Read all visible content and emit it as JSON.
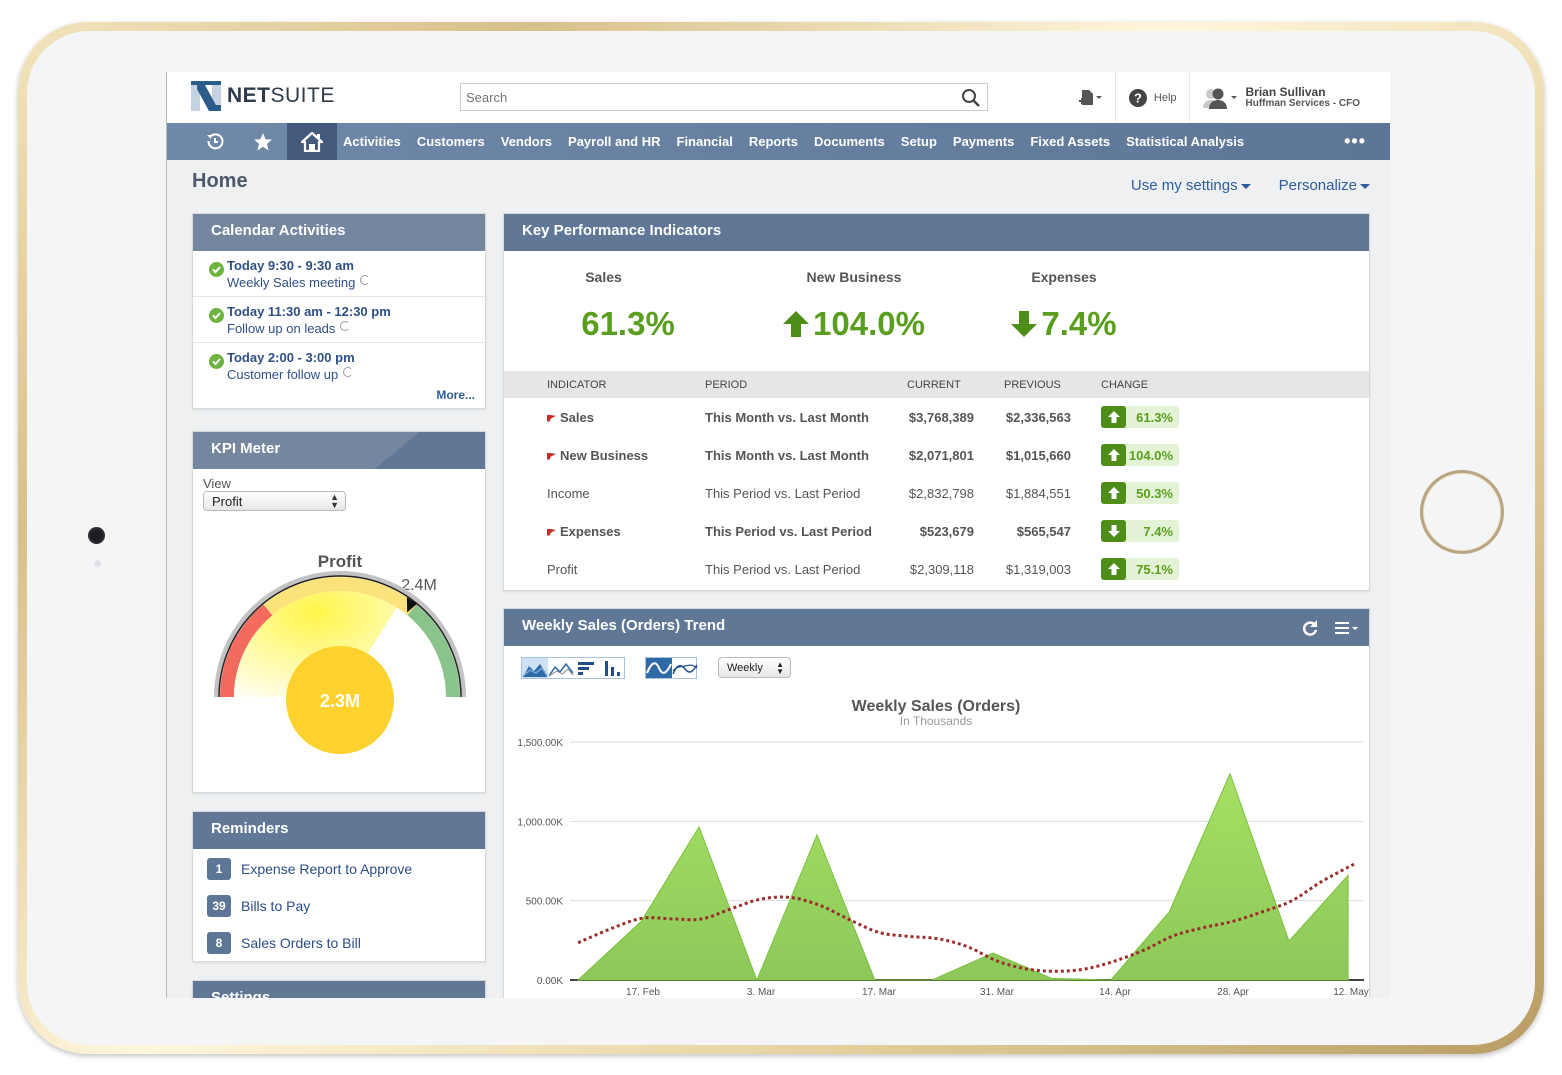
{
  "app": {
    "brand_bold": "NET",
    "brand_rest": "SUITE",
    "search_placeholder": "Search",
    "help_label": "Help",
    "user_name": "Brian Sullivan",
    "user_role": "Huffman Services - CFO"
  },
  "nav": {
    "icons": [
      "recent-icon",
      "star-icon",
      "home-icon"
    ],
    "items": [
      "Activities",
      "Customers",
      "Vendors",
      "Payroll and HR",
      "Financial",
      "Reports",
      "Documents",
      "Setup",
      "Payments",
      "Fixed Assets",
      "Statistical Analysis"
    ],
    "more": "•••"
  },
  "page": {
    "title": "Home",
    "use_settings": "Use my settings",
    "personalize": "Personalize"
  },
  "calendar": {
    "title": "Calendar Activities",
    "items": [
      {
        "time": "Today 9:30 - 9:30 am",
        "title": "Weekly Sales meeting"
      },
      {
        "time": "Today 11:30 am - 12:30 pm",
        "title": "Follow up on leads"
      },
      {
        "time": "Today 2:00 - 3:00 pm",
        "title": "Customer follow up"
      }
    ],
    "more": "More..."
  },
  "kpi_meter": {
    "title": "KPI Meter",
    "view_label": "View",
    "view_value": "Profit",
    "gauge_title": "Profit",
    "target_label": "2.4M",
    "value_label": "2.3M",
    "value_fraction": 0.68,
    "target_fraction": 0.72
  },
  "reminders": {
    "title": "Reminders",
    "items": [
      {
        "count": "1",
        "label": "Expense Report to Approve"
      },
      {
        "count": "39",
        "label": "Bills to Pay"
      },
      {
        "count": "8",
        "label": "Sales Orders to Bill"
      }
    ]
  },
  "settings": {
    "title": "Settings"
  },
  "kpi": {
    "title": "Key Performance Indicators",
    "summary": [
      {
        "label": "Sales",
        "value": "61.3%",
        "direction": "up"
      },
      {
        "label": "New Business",
        "value": "104.0%",
        "direction": "up"
      },
      {
        "label": "Expenses",
        "value": "7.4%",
        "direction": "down"
      }
    ],
    "headers": [
      "INDICATOR",
      "PERIOD",
      "CURRENT",
      "PREVIOUS",
      "CHANGE"
    ],
    "rows": [
      {
        "indicator": "Sales",
        "flag": true,
        "bold": true,
        "period": "This Month vs. Last Month",
        "current": "$3,768,389",
        "previous": "$2,336,563",
        "change": "61.3%",
        "direction": "up"
      },
      {
        "indicator": "New Business",
        "flag": true,
        "bold": true,
        "period": "This Month vs. Last Month",
        "current": "$2,071,801",
        "previous": "$1,015,660",
        "change": "104.0%",
        "direction": "up"
      },
      {
        "indicator": "Income",
        "flag": false,
        "bold": false,
        "period": "This Period vs. Last Period",
        "current": "$2,832,798",
        "previous": "$1,884,551",
        "change": "50.3%",
        "direction": "up"
      },
      {
        "indicator": "Expenses",
        "flag": true,
        "bold": true,
        "period": "This Period vs. Last Period",
        "current": "$523,679",
        "previous": "$565,547",
        "change": "7.4%",
        "direction": "down"
      },
      {
        "indicator": "Profit",
        "flag": false,
        "bold": false,
        "period": "This Period vs. Last Period",
        "current": "$2,309,118",
        "previous": "$1,319,003",
        "change": "75.1%",
        "direction": "up"
      }
    ]
  },
  "trend": {
    "title": "Weekly Sales (Orders) Trend",
    "interval": "Weekly"
  },
  "chart_data": {
    "type": "area",
    "title": "Weekly Sales (Orders)",
    "subtitle": "In Thousands",
    "xlabel": "",
    "ylabel": "",
    "ylim": [
      0,
      1500
    ],
    "yticks": [
      0,
      500,
      1000,
      1500
    ],
    "ytick_labels": [
      "0.00K",
      "500.00K",
      "1,000.00K",
      "1,500.00K"
    ],
    "xtick_labels": [
      "17. Feb",
      "3. Mar",
      "17. Mar",
      "31. Mar",
      "14. Apr",
      "28. Apr",
      "12. May"
    ],
    "xtick_week_index": [
      1,
      3,
      5,
      7,
      9,
      11,
      13
    ],
    "x_weeks": [
      -0.1,
      0.97,
      1.95,
      2.93,
      3.95,
      4.93,
      5.9,
      6.93,
      7.93,
      8.93,
      9.92,
      10.95,
      11.95,
      12.95
    ],
    "grid": true,
    "series": [
      {
        "name": "Sales (Orders)",
        "kind": "area",
        "color": "#8dcc4a",
        "values": [
          0,
          370,
          965,
          0,
          915,
          0,
          0,
          170,
          10,
          0,
          430,
          1300,
          245,
          660
        ]
      },
      {
        "name": "Trend",
        "kind": "dotted-line",
        "color": "#9b2d2a",
        "x": [
          -0.1,
          0.5,
          1.0,
          1.5,
          2.0,
          2.5,
          3.0,
          3.5,
          4.0,
          4.5,
          5.0,
          5.5,
          6.0,
          6.5,
          7.0,
          7.5,
          8.0,
          8.5,
          9.0,
          9.5,
          10.0,
          10.5,
          11.0,
          11.5,
          12.0,
          12.5,
          13.05
        ],
        "values": [
          235,
          330,
          390,
          385,
          385,
          450,
          510,
          520,
          470,
          380,
          300,
          275,
          260,
          210,
          120,
          70,
          55,
          70,
          120,
          190,
          280,
          330,
          370,
          430,
          500,
          620,
          730
        ]
      }
    ],
    "legend": "none"
  }
}
